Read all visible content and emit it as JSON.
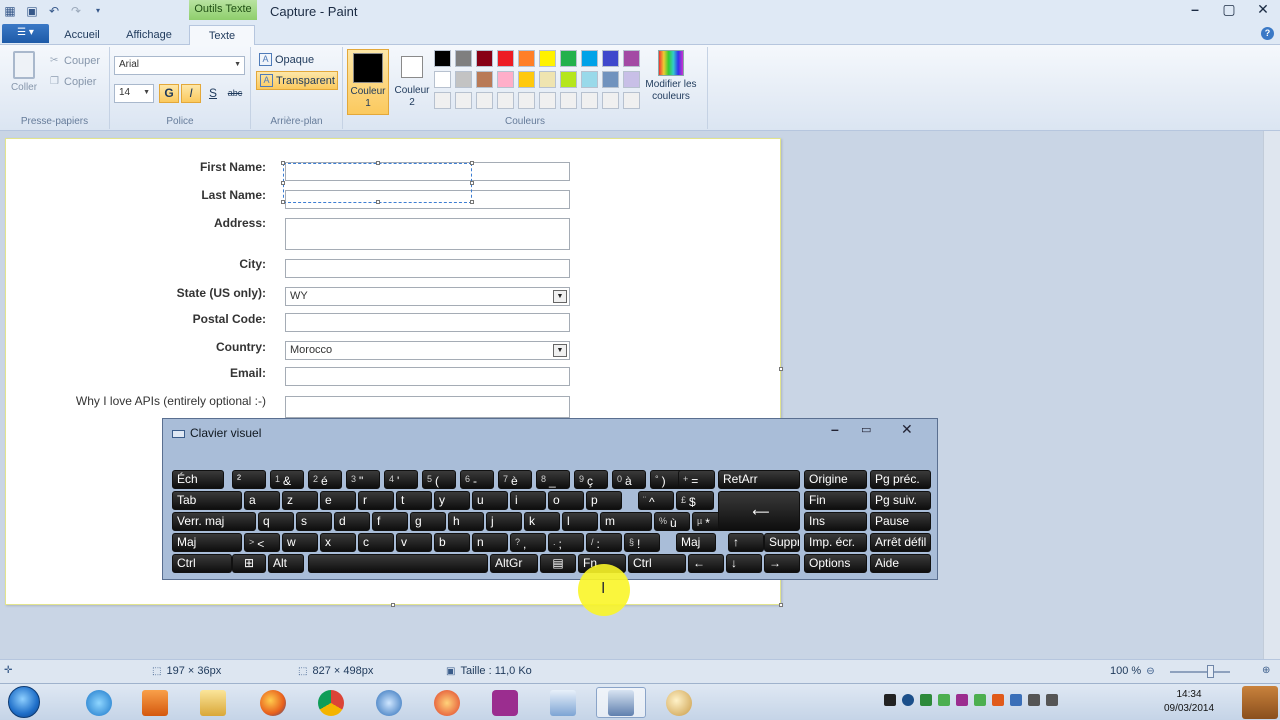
{
  "titlebar": {
    "context_tab": "Outils Texte",
    "title": "Capture - Paint"
  },
  "tabs": {
    "home": "Accueil",
    "view": "Affichage",
    "text": "Texte"
  },
  "clipboard": {
    "paste": "Coller",
    "cut": "Couper",
    "copy": "Copier",
    "label": "Presse-papiers"
  },
  "font": {
    "family": "Arial",
    "size": "14",
    "bold": "G",
    "italic": "I",
    "underline": "S",
    "strike": "abc",
    "label": "Police"
  },
  "background": {
    "opaque": "Opaque",
    "transparent": "Transparent",
    "label": "Arrière-plan"
  },
  "colors": {
    "color1": "Couleur 1",
    "color2": "Couleur 2",
    "edit": "Modifier les couleurs",
    "label": "Couleurs",
    "color1_value": "#000000",
    "color2_value": "#ffffff",
    "palette": [
      "#000000",
      "#7f7f7f",
      "#880015",
      "#ed1c24",
      "#ff7f27",
      "#fff200",
      "#22b14c",
      "#00a2e8",
      "#3f48cc",
      "#a349a4",
      "#ffffff",
      "#c3c3c3",
      "#b97a57",
      "#ffaec9",
      "#ffc90e",
      "#efe4b0",
      "#b5e61d",
      "#99d9ea",
      "#7092be",
      "#c8bfe7",
      "#f0f0f0",
      "#f0f0f0",
      "#f0f0f0",
      "#f0f0f0",
      "#f0f0f0",
      "#f0f0f0",
      "#f0f0f0",
      "#f0f0f0",
      "#f0f0f0",
      "#f0f0f0"
    ]
  },
  "form": {
    "first_name": "First Name:",
    "last_name": "Last Name:",
    "address": "Address:",
    "city": "City:",
    "state": "State (US only):",
    "state_value": "WY",
    "postal": "Postal Code:",
    "country": "Country:",
    "country_value": "Morocco",
    "email": "Email:",
    "why": "Why I love APIs (entirely optional :-)"
  },
  "osk": {
    "title": "Clavier visuel",
    "rows": [
      [
        "Éch",
        "²",
        "1 &",
        "2 é",
        "3 \"",
        "4 '",
        "5 (",
        "6 -",
        "7 è",
        "8 _",
        "9 ç",
        "0 à",
        "° )",
        "+ =",
        "RetArr",
        "Origine",
        "Pg préc."
      ],
      [
        "Tab",
        "a",
        "z",
        "e",
        "r",
        "t",
        "y",
        "u",
        "i",
        "o",
        "p",
        "¨ ^",
        "£ $",
        "Fin",
        "Pg suiv."
      ],
      [
        "Verr. maj",
        "q",
        "s",
        "d",
        "f",
        "g",
        "h",
        "j",
        "k",
        "l",
        "m",
        "% ù",
        "µ *",
        "Ins",
        "Pause"
      ],
      [
        "Maj",
        "> <",
        "w",
        "x",
        "c",
        "v",
        "b",
        "n",
        "? ,",
        ". ;",
        "/ :",
        "§ !",
        "Maj",
        "↑",
        "Suppr",
        "Imp. écr.",
        "Arrêt défil"
      ],
      [
        "Ctrl",
        "Alt",
        "AltGr",
        "Fn",
        "Ctrl",
        "←",
        "↓",
        "→",
        "Options",
        "Aide"
      ]
    ]
  },
  "status": {
    "selection": "197 × 36px",
    "canvas": "827 × 498px",
    "size": "Taille : 11,0 Ko",
    "zoom": "100 %"
  },
  "clock": {
    "time": "14:34",
    "date": "09/03/2014"
  }
}
